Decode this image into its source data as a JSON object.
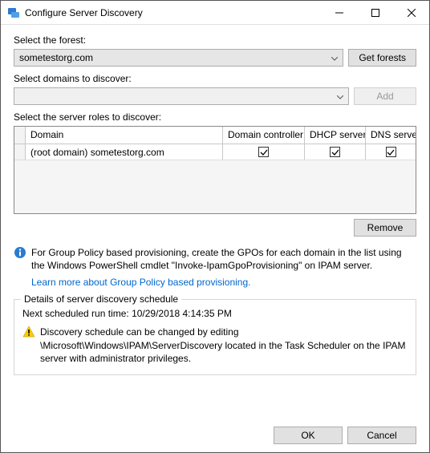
{
  "window": {
    "title": "Configure Server Discovery"
  },
  "forest": {
    "label": "Select the forest:",
    "value": "sometestorg.com",
    "button": "Get forests"
  },
  "domains": {
    "label": "Select domains to discover:",
    "value": "",
    "button": "Add"
  },
  "roles": {
    "label": "Select the server roles to discover:",
    "headers": {
      "domain": "Domain",
      "dc": "Domain controller",
      "dhcp": "DHCP server",
      "dns": "DNS server"
    },
    "rows": [
      {
        "domain": "(root domain) sometestorg.com",
        "dc": true,
        "dhcp": true,
        "dns": true
      }
    ],
    "remove": "Remove"
  },
  "info": {
    "text": "For Group Policy based provisioning, create the GPOs for each domain in the list using the Windows PowerShell cmdlet \"Invoke-IpamGpoProvisioning\" on IPAM server.",
    "link": "Learn more about Group Policy based provisioning."
  },
  "schedule": {
    "legend": "Details of server discovery schedule",
    "next_run": "Next scheduled run time: 10/29/2018 4:14:35 PM",
    "warning": "Discovery schedule can be changed by editing \\Microsoft\\Windows\\IPAM\\ServerDiscovery located in the Task Scheduler on the IPAM server with administrator privileges."
  },
  "footer": {
    "ok": "OK",
    "cancel": "Cancel"
  }
}
